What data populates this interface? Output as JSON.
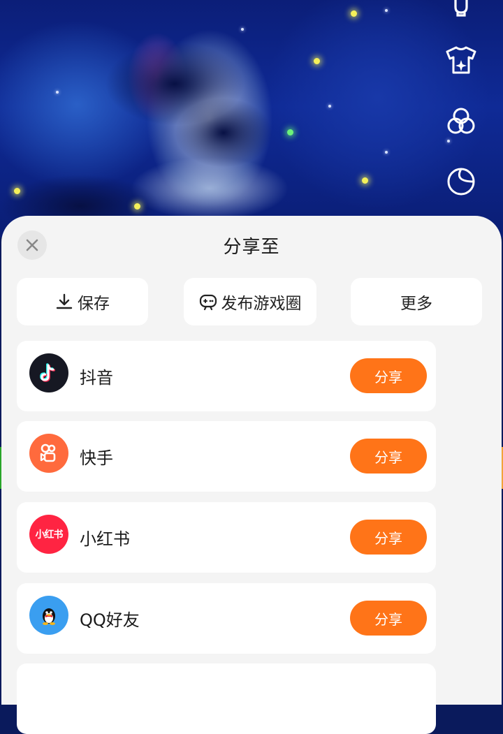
{
  "sheet": {
    "title": "分享至",
    "close_icon": "close-icon"
  },
  "actions": [
    {
      "label": "保存",
      "icon": "download-icon"
    },
    {
      "label": "发布游戏圈",
      "icon": "game-controller-icon"
    },
    {
      "label": "更多",
      "icon": ""
    }
  ],
  "share_targets": [
    {
      "name": "抖音",
      "button": "分享",
      "logo": "douyin-logo",
      "color": "#161823"
    },
    {
      "name": "快手",
      "button": "分享",
      "logo": "kuaishou-logo",
      "color": "#ff6a3d"
    },
    {
      "name": "小红书",
      "button": "分享",
      "logo": "xiaohongshu-logo",
      "logo_text": "小红书",
      "color": "#ff2442"
    },
    {
      "name": "QQ好友",
      "button": "分享",
      "logo": "qq-logo",
      "color": "#3a9ef0"
    }
  ],
  "side_tools": [
    "clothing-icon",
    "tshirt-sparkle-icon",
    "color-circles-icon",
    "moon-icon"
  ],
  "colors": {
    "accent": "#ff7418",
    "sheet_bg": "#f4f4f4",
    "card_bg": "#ffffff"
  }
}
